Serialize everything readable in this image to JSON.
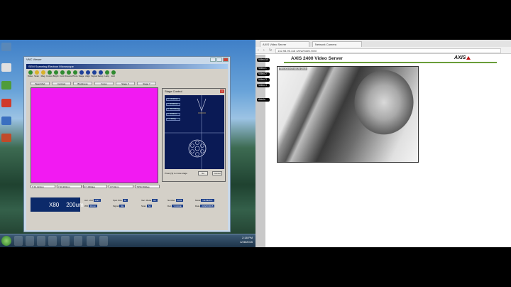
{
  "vnc": {
    "title": "VNC Viewer",
    "inner_title": "SEM Scanning Electron Microscope",
    "toolbar": [
      "Video",
      "Scan",
      "Mag",
      "Focus",
      "Bright",
      "Contr",
      "Freeze",
      "Photo",
      "Stage",
      "Align",
      "Signal",
      "Setup",
      "Help",
      "Exit"
    ],
    "tabs": [
      "Bead Mod",
      "Contrast",
      "Brightness",
      "Focus",
      "Stage X",
      "Stage Y"
    ],
    "coords": [
      "X:13.113mm",
      "Y:20.203mm",
      "Z:7.000deg",
      "R:5.0mm",
      "T:359.390deg"
    ],
    "magnification": "X80",
    "scale": "200um",
    "fields": [
      {
        "label": "Acc. Volt",
        "value": "20kV"
      },
      {
        "label": "Spot Size",
        "value": "40"
      },
      {
        "label": "Vac. Mode",
        "value": "HV"
      },
      {
        "label": "Number",
        "value": "0049"
      },
      {
        "label": "Mode",
        "value": "GENERAL"
      },
      {
        "label": "WD",
        "value": "19mm"
      },
      {
        "label": "Signal",
        "value": "SE"
      },
      {
        "label": "Scan",
        "value": "S4"
      },
      {
        "label": "Det.",
        "value": "Y-CAGE"
      },
      {
        "label": "Date",
        "value": "24APR2015"
      }
    ]
  },
  "stage_control": {
    "title": "Stage Control",
    "items": [
      "X: 13.113mm",
      "Y: 20.203mm",
      "R: 359.390deg",
      "Z: 19.00mm",
      "T: 0.00deg"
    ],
    "status": "Press [S] to move stage",
    "go_label": "Go",
    "cancel_label": "Cancel"
  },
  "browser": {
    "tab_title": "AXIS Video Server",
    "tab2_title": "Network Camera",
    "address": "132.98.95.118 /view/index.html",
    "page_title": "AXIS 2400 Video Server",
    "logo": "AXIS",
    "side_links": [
      "Video All",
      "Video 1",
      "Video 2",
      "Video 3",
      "Video 4",
      "Admin"
    ],
    "video_caption": "TRI 2015 07:48 26 2015"
  },
  "taskbar": {
    "time": "2:18 PM",
    "date": "4/28/2015"
  },
  "colors": {
    "canvas": "#f21af2",
    "stage_bg": "#0a1a55",
    "axis_green": "#6a9d3a"
  }
}
